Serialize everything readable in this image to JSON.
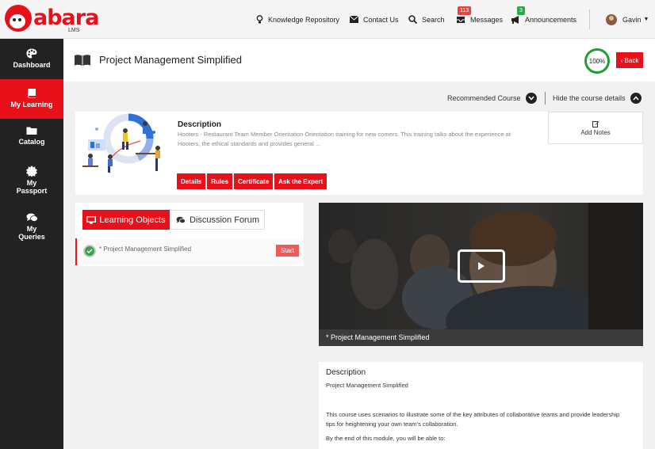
{
  "header": {
    "logo_text": "abara",
    "logo_sub": "LMS",
    "nav": {
      "knowledge": "Knowledge Repository",
      "contact": "Contact Us",
      "search": "Search",
      "messages": "Messages",
      "messages_count": "113",
      "announcements": "Announcements",
      "announcements_count": "3",
      "user": "Gavin"
    }
  },
  "sidebar": {
    "items": [
      {
        "label": "Dashboard",
        "icon": "palette-icon"
      },
      {
        "label": "My Learning",
        "icon": "book-icon",
        "active": true
      },
      {
        "label": "Catalog",
        "icon": "folder-icon"
      },
      {
        "label": "My Passport",
        "icon": "badge-icon"
      },
      {
        "label": "My Queries",
        "icon": "chat-icon"
      }
    ]
  },
  "course": {
    "title": "Project Management Simplified",
    "progress": "100%",
    "back_label": "Back",
    "recommended_label": "Recommended Course",
    "hide_details_label": "Hide the course details",
    "description_heading": "Description",
    "description_text": "Hooters - Restaurant Team Member Orientation Orientation training for new comers. This training talks about the experience at Hooters, the ethical standards and provides general ...",
    "add_notes_label": "Add Notes",
    "buttons": [
      "Details",
      "Rules",
      "Certificate",
      "Ask the Expert"
    ]
  },
  "learning": {
    "tab_objects": "Learning Objects",
    "tab_forum": "Discussion Forum",
    "item_name": "* Project Management Simplified",
    "start_label": "Start"
  },
  "video": {
    "caption": "* Project Management Simplified"
  },
  "details_panel": {
    "heading": "Description",
    "subtitle": "Project Management Simplified",
    "paragraph": "This course uses scenarios to illustrate some of the key attributes of collaborative teams and provide leadership tips for heightening your own team's collaboration.",
    "paragraph2": "By the end of this module, you will be able to:"
  },
  "colors": {
    "accent": "#e8111b",
    "sidebar": "#222222",
    "progress_ring": "#1e9e32"
  }
}
